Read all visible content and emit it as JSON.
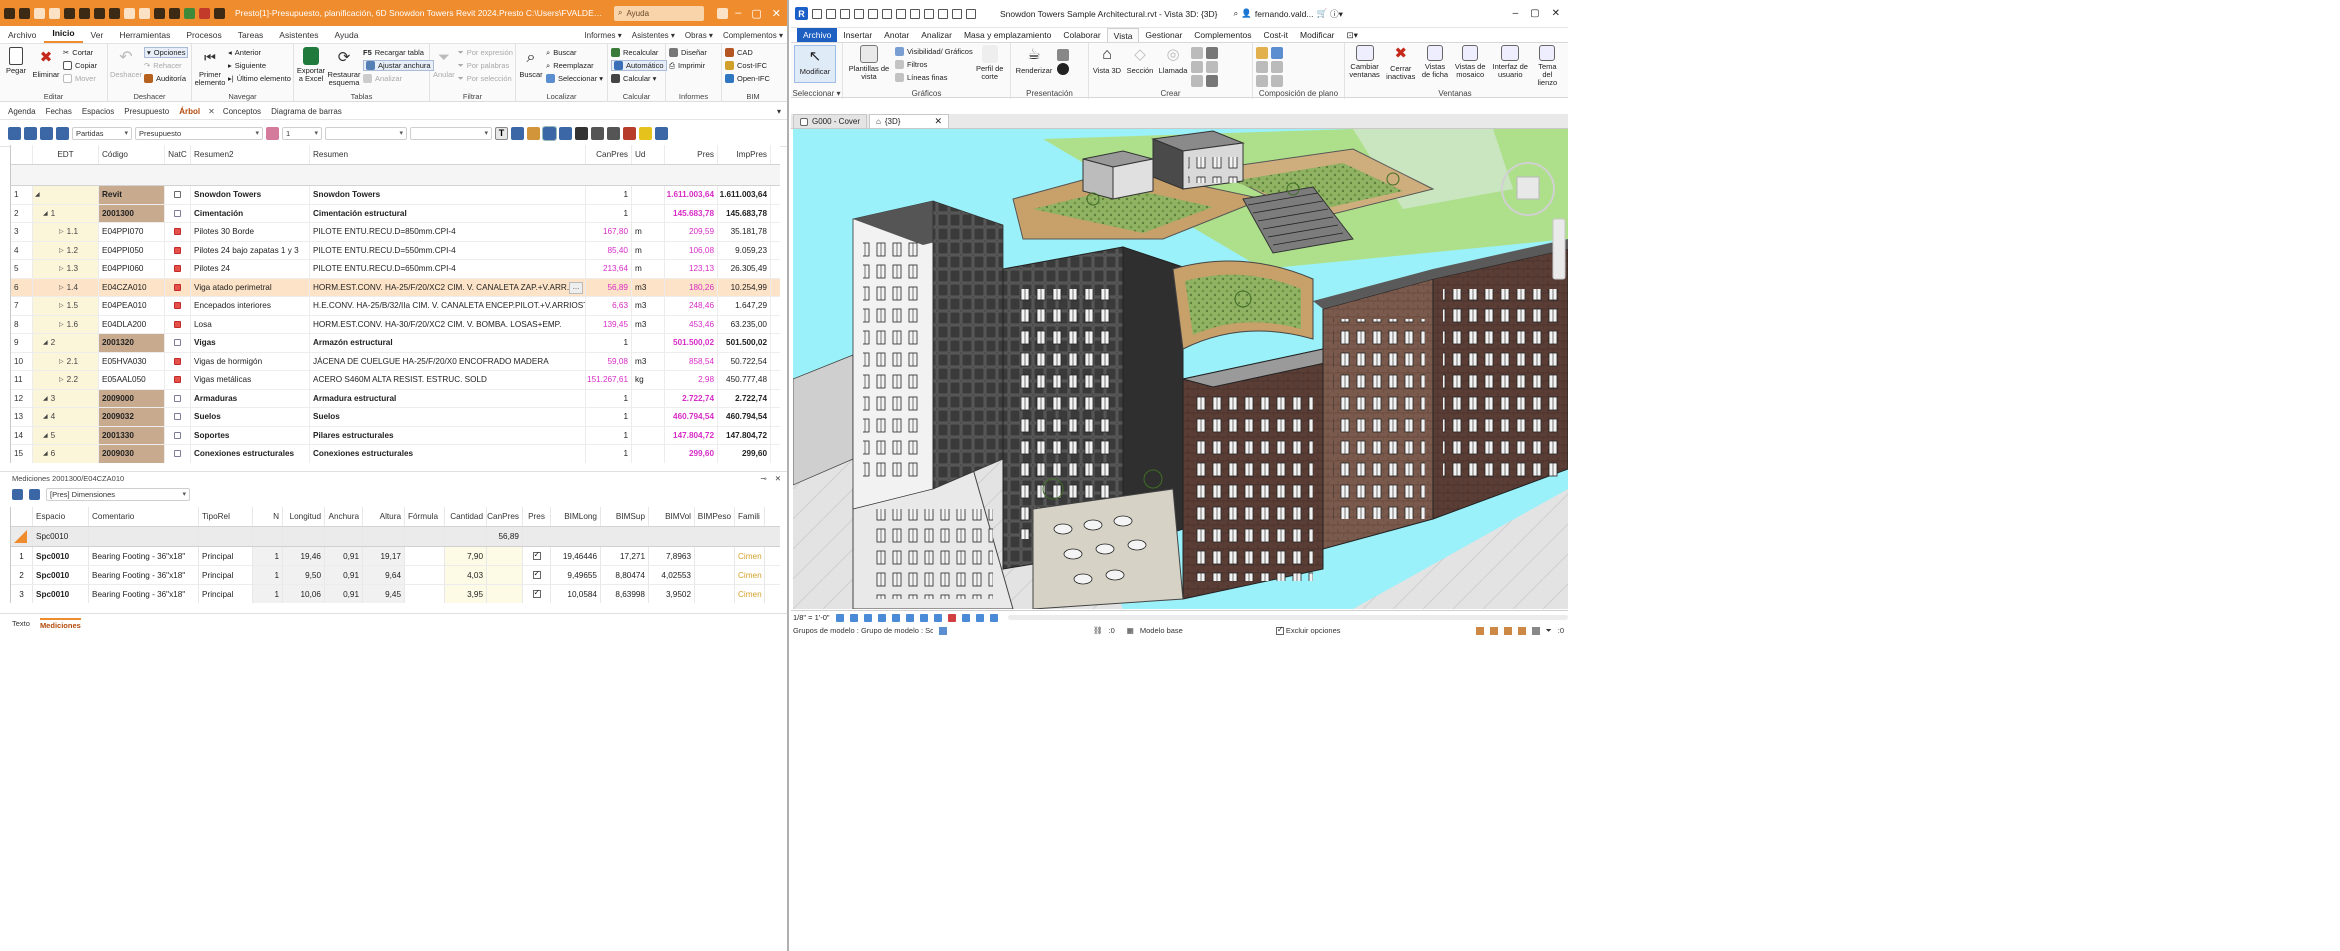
{
  "presto": {
    "title": "Presto[1]-Presupuesto, planificación, 6D Snowdon Towers Revit 2024.Presto  C:\\Users\\FVALDERRAMA\\OneD...",
    "search_placeholder": "Ayuda",
    "menu": [
      "Archivo",
      "Inicio",
      "Ver",
      "Herramientas",
      "Procesos",
      "Tareas",
      "Asistentes",
      "Ayuda"
    ],
    "menu_active": "Inicio",
    "menu_right": [
      "Informes ▾",
      "Asistentes ▾",
      "Obras ▾",
      "Complementos ▾"
    ],
    "ribbon": {
      "editar": {
        "label": "Editar",
        "pegar": "Pegar",
        "eliminar": "Eliminar",
        "cortar": "Cortar",
        "copiar": "Copiar",
        "mover": "Mover"
      },
      "deshacer": {
        "label": "Deshacer",
        "deshacer": "Deshacer",
        "opciones": "Opciones",
        "rehacer": "Rehacer",
        "auditoria": "Auditoría"
      },
      "navegar": {
        "label": "Navegar",
        "primer": "Primer elemento",
        "anterior": "Anterior",
        "siguiente": "Siguiente",
        "ultimo": "Último elemento"
      },
      "tablas": {
        "label": "Tablas",
        "exportar": "Exportar a Excel",
        "restaurar": "Restaurar esquema",
        "recargar": "Recargar tabla",
        "ajustar": "Ajustar anchura",
        "analizar": "Analizar"
      },
      "filtrar": {
        "label": "Filtrar",
        "anular": "Anular",
        "expresion": "Por expresión",
        "palabras": "Por palabras",
        "seleccion": "Por selección"
      },
      "localizar": {
        "label": "Localizar",
        "buscar_big": "Buscar",
        "buscar": "Buscar",
        "reemplazar": "Reemplazar",
        "seleccionar": "Seleccionar ▾"
      },
      "calcular": {
        "label": "Calcular",
        "recalcular": "Recalcular",
        "automatico": "Automático",
        "calcular": "Calcular ▾"
      },
      "informes": {
        "label": "Informes",
        "disenar": "Diseñar",
        "imprimir": "Imprimir"
      },
      "bim": {
        "label": "BIM",
        "cad": "CAD",
        "cost_ifc": "Cost-IFC",
        "open_ifc": "Open-IFC"
      }
    },
    "tabs": [
      "Agenda",
      "Fechas",
      "Espacios",
      "Presupuesto",
      "Árbol",
      "Conceptos",
      "Diagrama de barras"
    ],
    "tabs_active": "Árbol",
    "toolbar": {
      "combo1": "Partidas",
      "combo2": "Presupuesto",
      "combo3": "1"
    },
    "grid_headers": {
      "num": "",
      "edt": "EDT",
      "codigo": "Código",
      "natc": "NatC",
      "resumen2": "Resumen2",
      "resumen": "Resumen",
      "canpres": "CanPres",
      "ud": "Ud",
      "pres": "Pres",
      "imppres": "ImpPres"
    },
    "rows": [
      {
        "n": "1",
        "edt": "",
        "code": "Revit",
        "res2": "Snowdon Towers",
        "res": "Snowdon Towers",
        "can": "1",
        "ud": "",
        "pres": "1.611.003,64",
        "imp": "1.611.003,64",
        "lvl": 0,
        "bold": true,
        "natc": "p"
      },
      {
        "n": "2",
        "edt": "1",
        "code": "2001300",
        "res2": "Cimentación",
        "res": "Cimentación estructural",
        "can": "1",
        "ud": "",
        "pres": "145.683,78",
        "imp": "145.683,78",
        "lvl": 1,
        "bold": true,
        "natc": "r"
      },
      {
        "n": "3",
        "edt": "1.1",
        "code": "E04PPI070",
        "res2": "Pilotes 30 Borde",
        "res": "PILOTE ENTU.RECU.D=850mm.CPI-4",
        "can": "167,80",
        "ud": "m",
        "pres": "209,59",
        "imp": "35.181,78",
        "lvl": 2,
        "bold": false,
        "natc": "x"
      },
      {
        "n": "4",
        "edt": "1.2",
        "code": "E04PPI050",
        "res2": "Pilotes 24 bajo zapatas 1 y 3",
        "res": "PILOTE ENTU.RECU.D=550mm.CPI-4",
        "can": "85,40",
        "ud": "m",
        "pres": "106,08",
        "imp": "9.059,23",
        "lvl": 2,
        "bold": false,
        "natc": "x"
      },
      {
        "n": "5",
        "edt": "1.3",
        "code": "E04PPI060",
        "res2": "Pilotes 24",
        "res": "PILOTE ENTU.RECU.D=650mm.CPI-4",
        "can": "213,64",
        "ud": "m",
        "pres": "123,13",
        "imp": "26.305,49",
        "lvl": 2,
        "bold": false,
        "natc": "x"
      },
      {
        "n": "6",
        "edt": "1.4",
        "code": "E04CZA010",
        "res2": "Viga atado perimetral",
        "res": "HORM.EST.CONV. HA-25/F/20/XC2 CIM. V. CANALETA ZAP.+V.ARR.",
        "can": "56,89",
        "ud": "m3",
        "pres": "180,26",
        "imp": "10.254,99",
        "lvl": 2,
        "bold": false,
        "natc": "x",
        "sel": true
      },
      {
        "n": "7",
        "edt": "1.5",
        "code": "E04PEA010",
        "res2": "Encepados interiores",
        "res": "H.E.CONV. HA-25/B/32/IIa CIM. V. CANALETA ENCEP.PILOT.+V.ARRIOST.",
        "can": "6,63",
        "ud": "m3",
        "pres": "248,46",
        "imp": "1.647,29",
        "lvl": 2,
        "bold": false,
        "natc": "x"
      },
      {
        "n": "8",
        "edt": "1.6",
        "code": "E04DLA200",
        "res2": "Losa",
        "res": "HORM.EST.CONV. HA-30/F/20/XC2 CIM. V. BOMBA. LOSAS+EMP.",
        "can": "139,45",
        "ud": "m3",
        "pres": "453,46",
        "imp": "63.235,00",
        "lvl": 2,
        "bold": false,
        "natc": "x"
      },
      {
        "n": "9",
        "edt": "2",
        "code": "2001320",
        "res2": "Vigas",
        "res": "Armazón estructural",
        "can": "1",
        "ud": "",
        "pres": "501.500,02",
        "imp": "501.500,02",
        "lvl": 1,
        "bold": true,
        "natc": "r"
      },
      {
        "n": "10",
        "edt": "2.1",
        "code": "E05HVA030",
        "res2": "Vigas  de hormigón",
        "res": "JÁCENA DE CUELGUE HA-25/F/20/X0 ENCOFRADO MADERA",
        "can": "59,08",
        "ud": "m3",
        "pres": "858,54",
        "imp": "50.722,54",
        "lvl": 2,
        "bold": false,
        "natc": "x"
      },
      {
        "n": "11",
        "edt": "2.2",
        "code": "E05AAL050",
        "res2": "Vigas metálicas",
        "res": "ACERO S460M ALTA RESIST. ESTRUC. SOLD",
        "can": "151.267,61",
        "ud": "kg",
        "pres": "2,98",
        "imp": "450.777,48",
        "lvl": 2,
        "bold": false,
        "natc": "x"
      },
      {
        "n": "12",
        "edt": "3",
        "code": "2009000",
        "res2": "Armaduras",
        "res": "Armadura estructural",
        "can": "1",
        "ud": "",
        "pres": "2.722,74",
        "imp": "2.722,74",
        "lvl": 1,
        "bold": true,
        "natc": "r"
      },
      {
        "n": "13",
        "edt": "4",
        "code": "2009032",
        "res2": "Suelos",
        "res": "Suelos",
        "can": "1",
        "ud": "",
        "pres": "460.794,54",
        "imp": "460.794,54",
        "lvl": 1,
        "bold": true,
        "natc": "r"
      },
      {
        "n": "14",
        "edt": "5",
        "code": "2001330",
        "res2": "Soportes",
        "res": "Pilares estructurales",
        "can": "1",
        "ud": "",
        "pres": "147.804,72",
        "imp": "147.804,72",
        "lvl": 1,
        "bold": true,
        "natc": "r"
      },
      {
        "n": "15",
        "edt": "6",
        "code": "2009030",
        "res2": "Conexiones estructurales",
        "res": "Conexiones estructurales",
        "can": "1",
        "ud": "",
        "pres": "299,60",
        "imp": "299,60",
        "lvl": 1,
        "bold": true,
        "natc": "r"
      }
    ],
    "mediciones": {
      "title": "Mediciones 2001300/E04CZA010",
      "combo": "[Pres] Dimensiones",
      "headers": {
        "espacio": "Espacio",
        "comentario": "Comentario",
        "tiporel": "TipoRel",
        "n": "N",
        "longitud": "Longitud",
        "anchura": "Anchura",
        "altura": "Altura",
        "formula": "Fórmula",
        "cantidad": "Cantidad",
        "canpres": "CanPres",
        "pres": "Pres",
        "bimlong": "BIMLong",
        "bimsup": "BIMSup",
        "bimvol": "BIMVol",
        "bimpeso": "BIMPeso",
        "familia": "Famili"
      },
      "summary": {
        "espacio": "Spc0010",
        "canpres": "56,89"
      },
      "rows": [
        {
          "n": "1",
          "esp": "Spc0010",
          "com": "Bearing Footing - 36\"x18\"",
          "tip": "Principal",
          "N": "1",
          "lon": "19,46",
          "anc": "0,91",
          "alt": "19,17",
          "can": "7,90",
          "bl": "19,46446",
          "bs": "17,271",
          "bv": "7,8963",
          "fam": "Cimen"
        },
        {
          "n": "2",
          "esp": "Spc0010",
          "com": "Bearing Footing - 36\"x18\"",
          "tip": "Principal",
          "N": "1",
          "lon": "9,50",
          "anc": "0,91",
          "alt": "9,64",
          "can": "4,03",
          "bl": "9,49655",
          "bs": "8,80474",
          "bv": "4,02553",
          "fam": "Cimen"
        },
        {
          "n": "3",
          "esp": "Spc0010",
          "com": "Bearing Footing - 36\"x18\"",
          "tip": "Principal",
          "N": "1",
          "lon": "10,06",
          "anc": "0,91",
          "alt": "9,45",
          "can": "3,95",
          "bl": "10,0584",
          "bs": "8,63998",
          "bv": "3,9502",
          "fam": "Cimen"
        }
      ]
    },
    "status_tabs": [
      "Texto",
      "Mediciones"
    ],
    "status_active": "Mediciones"
  },
  "revit": {
    "title": "Snowdon Towers Sample Architectural.rvt - Vista 3D: {3D}",
    "user": "fernando.vald...",
    "menu": [
      "Archivo",
      "Insertar",
      "Anotar",
      "Analizar",
      "Masa y emplazamiento",
      "Colaborar",
      "Vista",
      "Gestionar",
      "Complementos",
      "Cost-it",
      "Modificar"
    ],
    "menu_active": "Vista",
    "ribbon": {
      "seleccionar": {
        "label": "Seleccionar ▾",
        "modificar": "Modificar"
      },
      "graficos": {
        "label": "Gráficos",
        "plantillas": "Plantillas de vista",
        "visibilidad": "Visibilidad/ Gráficos",
        "filtros": "Filtros",
        "lineas": "Líneas finas",
        "perfil": "Perfil de corte"
      },
      "presentacion": {
        "label": "Presentación",
        "renderizar": "Renderizar"
      },
      "crear": {
        "label": "Crear",
        "vista3d": "Vista 3D",
        "seccion": "Sección",
        "llamada": "Llamada"
      },
      "composicion": {
        "label": "Composición de plano"
      },
      "ventanas": {
        "label": "Ventanas",
        "cambiar": "Cambiar ventanas",
        "cerrar": "Cerrar inactivas",
        "vistas_ficha": "Vistas de ficha",
        "vistas_mosaico": "Vistas de mosaico",
        "interfaz": "Interfaz de usuario",
        "tema": "Tema del lienzo"
      }
    },
    "tabs": [
      {
        "label": "G000 - Cover"
      },
      {
        "label": "{3D}"
      }
    ],
    "scale": "1/8\" = 1'-0\"",
    "status_left": "Grupos de modelo : Grupo de modelo : Sc",
    "status_modelo": "Modelo base",
    "status_excluir": "Excluir opciones",
    "status_zero1": ":0",
    "status_zero2": ":0",
    "colors": {
      "sky": "#9bf1f9",
      "brick": "#5a3e36",
      "dark_panel": "#3c3c3c"
    }
  }
}
